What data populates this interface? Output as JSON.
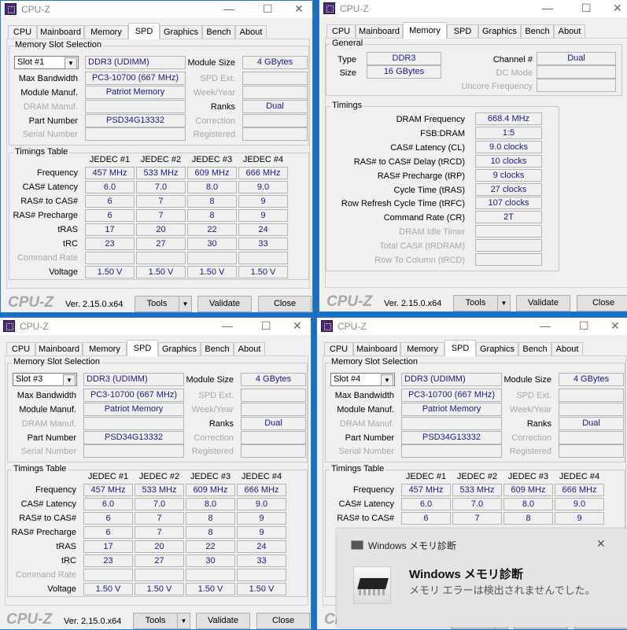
{
  "app_title": "CPU-Z",
  "window_buttons": {
    "minimize": "—",
    "maximize": "☐",
    "close": "✕"
  },
  "tabs": [
    "CPU",
    "Mainboard",
    "Memory",
    "SPD",
    "Graphics",
    "Bench",
    "About"
  ],
  "footer": {
    "logo": "CPU-Z",
    "version": "Ver. 2.15.0.x64",
    "tools": "Tools",
    "validate": "Validate",
    "close": "Close"
  },
  "spd_labels": {
    "group": "Memory Slot Selection",
    "max_bandwidth": "Max Bandwidth",
    "module_manuf": "Module Manuf.",
    "dram_manuf": "DRAM Manuf.",
    "part_number": "Part Number",
    "serial_number": "Serial Number",
    "module_size": "Module Size",
    "spd_ext": "SPD Ext.",
    "week_year": "Week/Year",
    "ranks": "Ranks",
    "correction": "Correction",
    "registered": "Registered",
    "timings_group": "Timings Table",
    "jedec_headers": [
      "JEDEC #1",
      "JEDEC #2",
      "JEDEC #3",
      "JEDEC #4"
    ],
    "row_labels": [
      "Frequency",
      "CAS# Latency",
      "RAS# to CAS#",
      "RAS# Precharge",
      "tRAS",
      "tRC",
      "Command Rate",
      "Voltage"
    ]
  },
  "spd_windows": [
    {
      "slot": "Slot #1",
      "type": "DDR3 (UDIMM)",
      "max_bandwidth": "PC3-10700 (667 MHz)",
      "module_manuf": "Patriot Memory",
      "part_number": "PSD34G13332",
      "module_size": "4 GBytes",
      "ranks": "Dual",
      "timings": [
        [
          "457 MHz",
          "533 MHz",
          "609 MHz",
          "666 MHz"
        ],
        [
          "6.0",
          "7.0",
          "8.0",
          "9.0"
        ],
        [
          "6",
          "7",
          "8",
          "9"
        ],
        [
          "6",
          "7",
          "8",
          "9"
        ],
        [
          "17",
          "20",
          "22",
          "24"
        ],
        [
          "23",
          "27",
          "30",
          "33"
        ],
        [
          "",
          "",
          "",
          ""
        ],
        [
          "1.50 V",
          "1.50 V",
          "1.50 V",
          "1.50 V"
        ]
      ]
    },
    {
      "slot": "Slot #3",
      "type": "DDR3 (UDIMM)",
      "max_bandwidth": "PC3-10700 (667 MHz)",
      "module_manuf": "Patriot Memory",
      "part_number": "PSD34G13332",
      "module_size": "4 GBytes",
      "ranks": "Dual",
      "timings": [
        [
          "457 MHz",
          "533 MHz",
          "609 MHz",
          "666 MHz"
        ],
        [
          "6.0",
          "7.0",
          "8.0",
          "9.0"
        ],
        [
          "6",
          "7",
          "8",
          "9"
        ],
        [
          "6",
          "7",
          "8",
          "9"
        ],
        [
          "17",
          "20",
          "22",
          "24"
        ],
        [
          "23",
          "27",
          "30",
          "33"
        ],
        [
          "",
          "",
          "",
          ""
        ],
        [
          "1.50 V",
          "1.50 V",
          "1.50 V",
          "1.50 V"
        ]
      ]
    },
    {
      "slot": "Slot #4",
      "type": "DDR3 (UDIMM)",
      "max_bandwidth": "PC3-10700 (667 MHz)",
      "module_manuf": "Patriot Memory",
      "part_number": "PSD34G13332",
      "module_size": "4 GBytes",
      "ranks": "Dual",
      "timings": [
        [
          "457 MHz",
          "533 MHz",
          "609 MHz",
          "666 MHz"
        ],
        [
          "6.0",
          "7.0",
          "8.0",
          "9.0"
        ],
        [
          "6",
          "7",
          "8",
          "9"
        ]
      ]
    }
  ],
  "memory_window": {
    "general_group": "General",
    "type_label": "Type",
    "type": "DDR3",
    "size_label": "Size",
    "size": "16 GBytes",
    "channel_label": "Channel #",
    "channel": "Dual",
    "dc_mode_label": "DC Mode",
    "uncore_label": "Uncore Frequency",
    "timings_group": "Timings",
    "timings": [
      {
        "label": "DRAM Frequency",
        "value": "668.4 MHz"
      },
      {
        "label": "FSB:DRAM",
        "value": "1:5"
      },
      {
        "label": "CAS# Latency (CL)",
        "value": "9.0 clocks"
      },
      {
        "label": "RAS# to CAS# Delay (tRCD)",
        "value": "10 clocks"
      },
      {
        "label": "RAS# Precharge (tRP)",
        "value": "9 clocks"
      },
      {
        "label": "Cycle Time (tRAS)",
        "value": "27 clocks"
      },
      {
        "label": "Row Refresh Cycle Time (tRFC)",
        "value": "107 clocks"
      },
      {
        "label": "Command Rate (CR)",
        "value": "2T"
      },
      {
        "label": "DRAM Idle Timer",
        "value": ""
      },
      {
        "label": "Total CAS# (tRDRAM)",
        "value": ""
      },
      {
        "label": "Row To Column (tRCD)",
        "value": ""
      }
    ]
  },
  "notification": {
    "app_name": "Windows メモリ診断",
    "close": "✕",
    "title": "Windows メモリ診断",
    "message": "メモリ エラーは検出されませんでした。"
  }
}
